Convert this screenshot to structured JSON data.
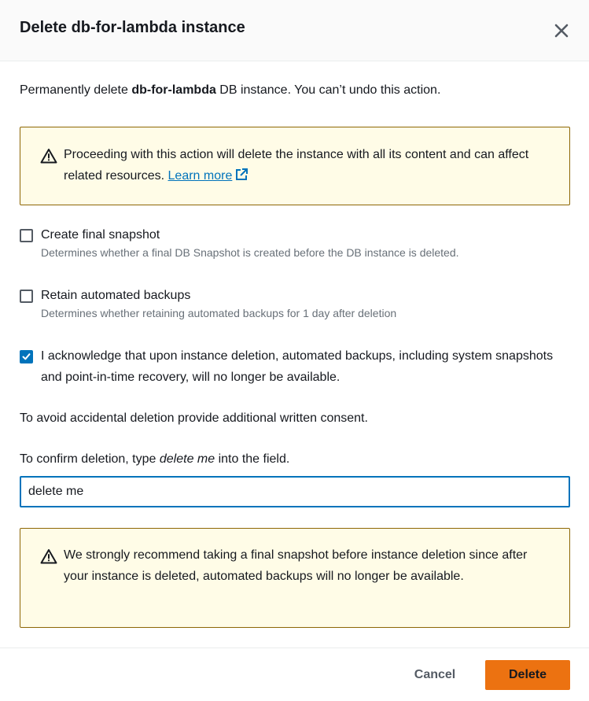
{
  "modal": {
    "title": "Delete db-for-lambda instance",
    "intro": {
      "prefix": "Permanently delete ",
      "instance_name": "db-for-lambda",
      "suffix": " DB instance. You can’t undo this action."
    },
    "warning": {
      "text": "Proceeding with this action will delete the instance with all its content and can affect related resources.",
      "link_label": "Learn more"
    },
    "options": [
      {
        "label": "Create final snapshot",
        "description": "Determines whether a final DB Snapshot is created before the DB instance is deleted.",
        "checked": false
      },
      {
        "label": "Retain automated backups",
        "description": "Determines whether retaining automated backups for 1 day after deletion",
        "checked": false
      },
      {
        "label": "I acknowledge that upon instance deletion, automated backups, including system snapshots and point-in-time recovery, will no longer be available.",
        "checked": true
      }
    ],
    "consent_text": "To avoid accidental deletion provide additional written consent.",
    "confirm": {
      "prefix": "To confirm deletion, type ",
      "phrase": "delete me",
      "suffix": " into the field.",
      "value": "delete me"
    },
    "recommendation": "We strongly recommend taking a final snapshot before instance deletion since after your instance is deleted, automated backups will no longer be available.",
    "buttons": {
      "cancel": "Cancel",
      "delete": "Delete"
    }
  },
  "colors": {
    "accent": "#0073bb",
    "primary_button": "#ec7211",
    "alert_background": "#fffce7",
    "alert_border": "#8d6605"
  },
  "icons": {
    "close": "close-icon",
    "warning": "warning-icon",
    "external_link": "external-link-icon",
    "checkmark": "checkmark-icon"
  }
}
